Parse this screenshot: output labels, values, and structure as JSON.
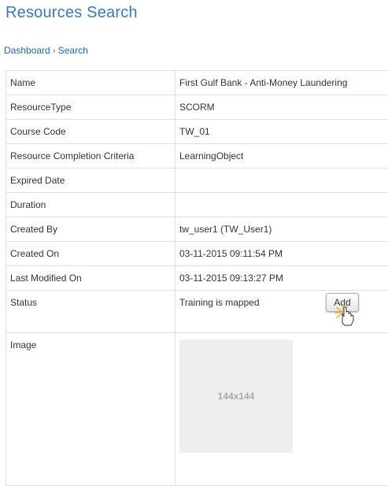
{
  "header": {
    "title": "Resources Search"
  },
  "breadcrumb": {
    "home": "Dashboard",
    "separator": "›",
    "current": "Search"
  },
  "details": {
    "rows": [
      {
        "label": "Name",
        "value": "First Gulf Bank - Anti-Money Laundering"
      },
      {
        "label": "ResourceType",
        "value": "SCORM"
      },
      {
        "label": "Course Code",
        "value": "TW_01"
      },
      {
        "label": "Resource Completion Criteria",
        "value": "LearningObject"
      },
      {
        "label": "Expired Date",
        "value": ""
      },
      {
        "label": "Duration",
        "value": ""
      },
      {
        "label": "Created By",
        "value": "tw_user1 (TW_User1)"
      },
      {
        "label": "Created On",
        "value": "03-11-2015 09:11:54 PM"
      },
      {
        "label": "Last Modified On",
        "value": "03-11-2015 09:13:27 PM"
      }
    ],
    "status": {
      "label": "Status",
      "value": "Training is mapped",
      "button_label": "Add"
    },
    "image": {
      "label": "Image",
      "placeholder_text": "144x144"
    }
  },
  "colors": {
    "title": "#3b78b5",
    "link": "#2a6496",
    "border": "#dddddd",
    "placeholder_bg": "#eeeeee"
  },
  "icons": {
    "cursor": "hand-pointer-icon"
  }
}
